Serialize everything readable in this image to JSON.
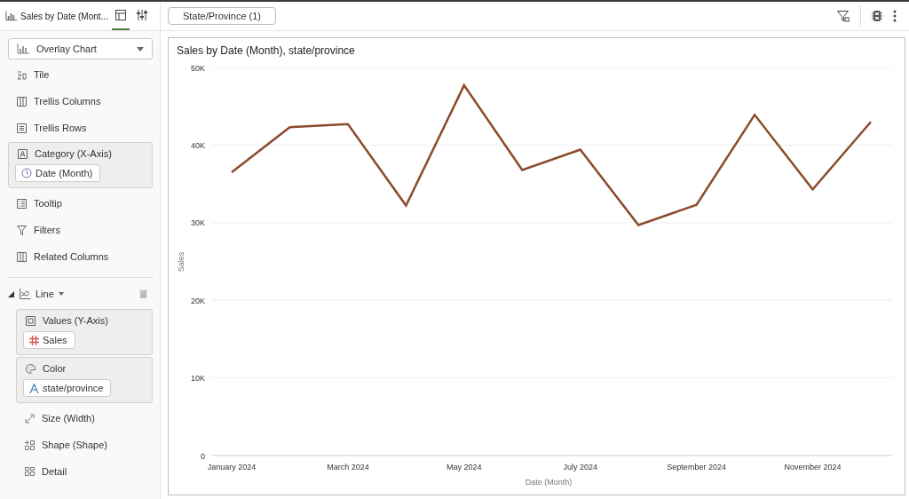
{
  "header": {
    "title": "Sales by Date (Mont...",
    "tabs": [
      {
        "selected": true
      },
      {
        "selected": false
      }
    ],
    "filter_chip": "State/Province (1)"
  },
  "sidebar": {
    "chart_type": "Overlay Chart",
    "items": [
      {
        "kind": "item",
        "label": "Tile"
      },
      {
        "kind": "item",
        "label": "Trellis Columns"
      },
      {
        "kind": "item",
        "label": "Trellis Rows"
      },
      {
        "kind": "group",
        "label": "Category (X-Axis)",
        "chip": "Date (Month)"
      },
      {
        "kind": "item",
        "label": "Tooltip"
      },
      {
        "kind": "item",
        "label": "Filters"
      },
      {
        "kind": "item",
        "label": "Related Columns"
      }
    ],
    "layer": {
      "label": "Line",
      "expanded": true,
      "items": [
        {
          "kind": "group",
          "label": "Values (Y-Axis)",
          "chip": "Sales"
        },
        {
          "kind": "group",
          "label": "Color",
          "chip": "state/province"
        },
        {
          "kind": "item",
          "label": "Size (Width)"
        },
        {
          "kind": "item",
          "label": "Shape (Shape)"
        },
        {
          "kind": "item",
          "label": "Detail"
        }
      ]
    }
  },
  "chart": {
    "chart_data": {
      "type": "line",
      "title": "Sales by Date (Month), state/province",
      "xlabel": "Date (Month)",
      "ylabel": "Sales",
      "categories": [
        "January 2024",
        null,
        "March 2024",
        null,
        "May 2024",
        null,
        "July 2024",
        null,
        "September 2024",
        null,
        "November 2024",
        null
      ],
      "ylim": [
        0,
        50000
      ],
      "grid": true,
      "yticks": [
        {
          "value": 0,
          "label": "0"
        },
        {
          "value": 10000,
          "label": "10K"
        },
        {
          "value": 20000,
          "label": "20K"
        },
        {
          "value": 30000,
          "label": "30K"
        },
        {
          "value": 40000,
          "label": "40K"
        },
        {
          "value": 50000,
          "label": "50K"
        }
      ],
      "series": [
        {
          "color": "#8b4a2b",
          "values": [
            36500,
            42300,
            42700,
            32200,
            47700,
            36800,
            39400,
            29700,
            32300,
            43900,
            34300,
            43000
          ]
        }
      ]
    }
  }
}
